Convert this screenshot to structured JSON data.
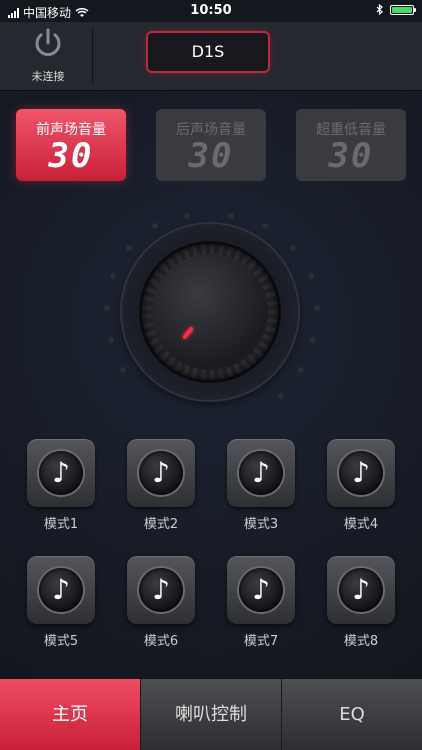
{
  "status_bar": {
    "carrier": "中国移动",
    "time": "10:50",
    "battery_color": "#4cd964"
  },
  "header": {
    "power_label": "未连接",
    "device_name": "D1S"
  },
  "volume_cards": [
    {
      "label": "前声场音量",
      "value": "30",
      "active": true
    },
    {
      "label": "后声场音量",
      "value": "30",
      "active": false
    },
    {
      "label": "超重低音量",
      "value": "30",
      "active": false
    }
  ],
  "modes": [
    {
      "label": "模式1"
    },
    {
      "label": "模式2"
    },
    {
      "label": "模式3"
    },
    {
      "label": "模式4"
    },
    {
      "label": "模式5"
    },
    {
      "label": "模式6"
    },
    {
      "label": "模式7"
    },
    {
      "label": "模式8"
    }
  ],
  "tabs": [
    {
      "label": "主页",
      "active": true
    },
    {
      "label": "喇叭控制",
      "active": false
    },
    {
      "label": "EQ",
      "active": false
    }
  ],
  "colors": {
    "accent": "#e0344c",
    "background": "#15171e"
  },
  "icons": {
    "mode_icon": "music-note-icon",
    "power_icon": "power-icon"
  }
}
